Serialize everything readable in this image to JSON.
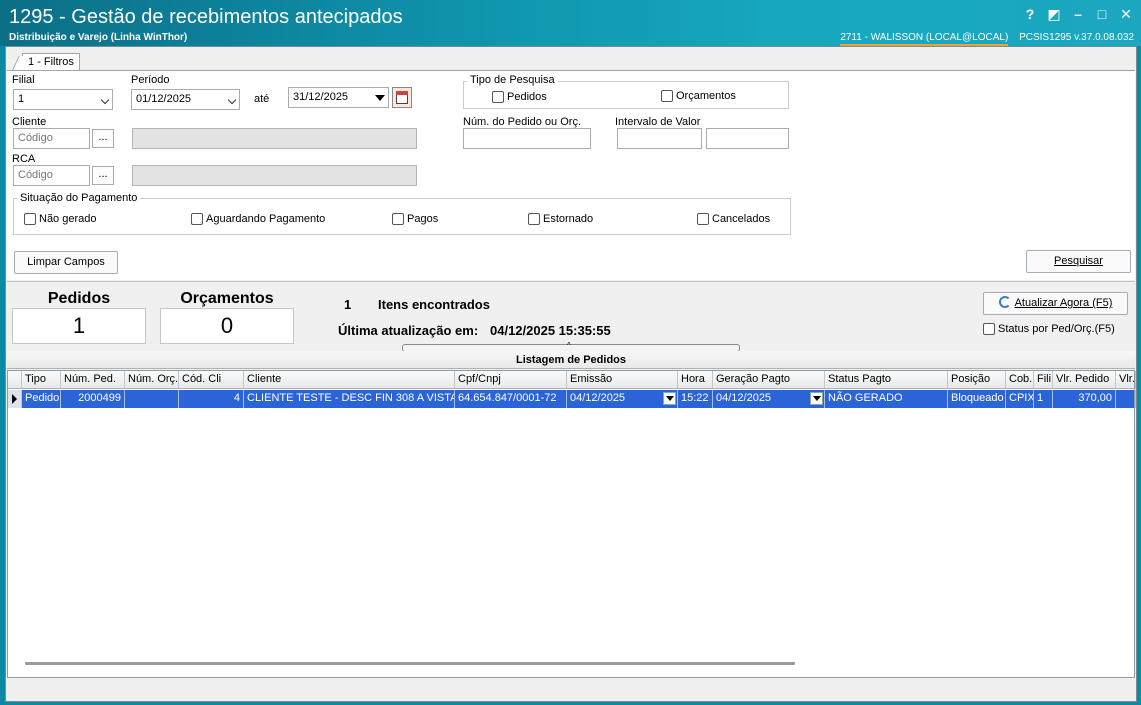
{
  "window": {
    "title": "1295 - Gestão de recebimentos antecipados",
    "subtitle": "Distribuição e Varejo (Linha WinThor)",
    "user": "2711 - WALISSON (LOCAL@LOCAL)",
    "module": "PCSIS1295",
    "version": "v.37.0.08.032",
    "controls": [
      "?",
      "◩",
      "–",
      "□",
      "✕"
    ]
  },
  "tabs": [
    {
      "label": "1 - Filtros"
    }
  ],
  "filters": {
    "filial_label": "Filial",
    "filial_value": "1",
    "periodo_label": "Período",
    "periodo_start": "01/12/2025",
    "ate_label": "até",
    "periodo_end": "31/12/2025",
    "cliente_label": "Cliente",
    "cliente_placeholder": "Código",
    "rca_label": "RCA",
    "rca_placeholder": "Código",
    "lookup_button": "...",
    "tipo_pesquisa": {
      "title": "Tipo de Pesquisa",
      "options": [
        {
          "label": "Pedidos",
          "checked": false
        },
        {
          "label": "Orçamentos",
          "checked": false
        }
      ]
    },
    "num_pedido_label": "Núm. do Pedido ou Orç.",
    "intervalo_valor_label": "Intervalo de Valor",
    "situacao": {
      "title": "Situação do Pagamento",
      "options": [
        {
          "label": "Não gerado",
          "checked": false
        },
        {
          "label": "Aguardando Pagamento",
          "checked": false
        },
        {
          "label": "Pagos",
          "checked": false
        },
        {
          "label": "Estornado",
          "checked": false
        },
        {
          "label": "Cancelados",
          "checked": false
        }
      ]
    },
    "limpar_button": "Limpar Campos",
    "pesquisar_button": "Pesquisar"
  },
  "summary": {
    "pedidos_title": "Pedidos",
    "pedidos_count": "1",
    "orcamentos_title": "Orçamentos",
    "orcamentos_count": "0",
    "items_count": "1",
    "items_label": "Itens encontrados",
    "last_update_label": "Última atualização em:",
    "last_update_value": "04/12/2025 15:35:55",
    "refresh_button": "Atualizar Agora (F5)",
    "status_checkbox": "Status por Ped/Orç.(F5)"
  },
  "grid": {
    "title": "Listagem de Pedidos",
    "columns": [
      "Tipo",
      "Núm. Ped.",
      "Núm. Orç.",
      "Cód. Cli",
      "Cliente",
      "Cpf/Cnpj",
      "Emissão",
      "Hora",
      "Geração Pagto",
      "Status Pagto",
      "Posição",
      "Cob.",
      "Fili",
      "Vlr. Pedido",
      "Vlr."
    ],
    "rows": [
      [
        "Pedido",
        "2000499",
        "",
        "4",
        "CLIENTE TESTE - DESC FIN 308 A VISTA",
        "64.654.847/0001-72",
        "04/12/2025",
        "15:22",
        "04/12/2025",
        "NÃO GERADO",
        "Bloqueado",
        "CPIX",
        "1",
        "370,00",
        ""
      ]
    ]
  },
  "colors": {
    "titlebar": "#0f93ad",
    "selected_row": "#2b63d8",
    "accent_underline": "#e8a33b"
  }
}
